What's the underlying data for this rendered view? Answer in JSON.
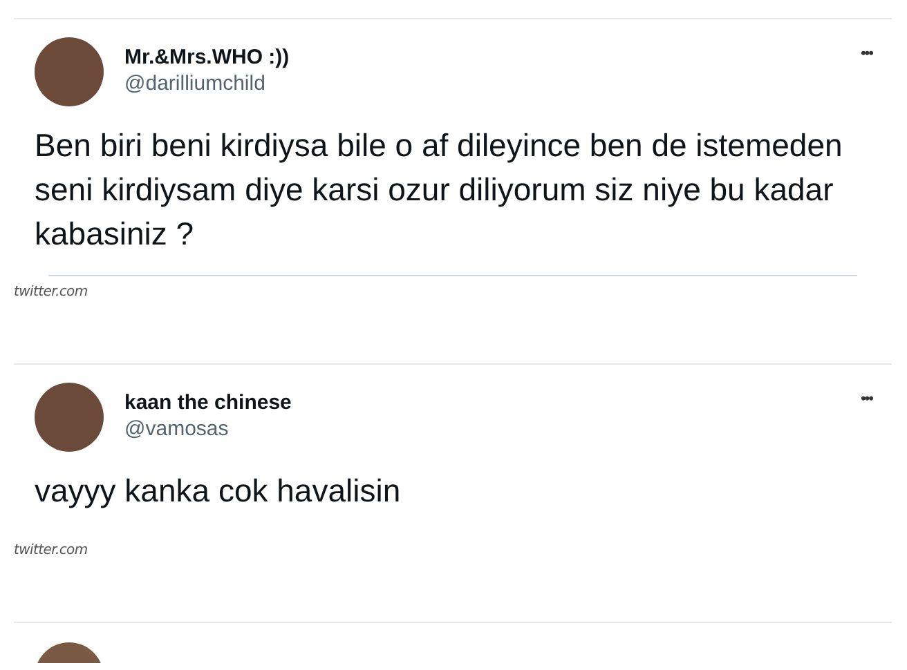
{
  "tweets": [
    {
      "kind": "full",
      "name": "Mr.&Mrs.WHO :))",
      "handle": "@darilliumchild",
      "more": "•••",
      "text": "Ben biri beni kirdiysa bile o af dileyince ben de istemeden seni kirdiysam diye karsi ozur diliyorum siz niye bu kadar kabasiniz ?",
      "bottom_rule": true,
      "source": "twitter.com"
    },
    {
      "kind": "full",
      "name": "kaan the chinese",
      "handle": "@vamosas",
      "more": "•••",
      "text": "vayyy kanka cok havalisin",
      "bottom_rule": false,
      "source": "twitter.com"
    },
    {
      "kind": "partial"
    }
  ]
}
